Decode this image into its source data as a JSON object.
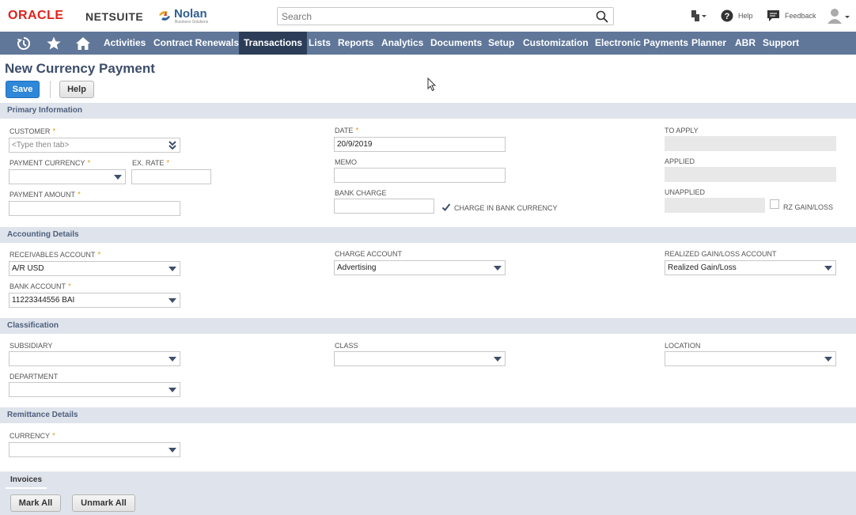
{
  "header": {
    "oracle": "ORACLE",
    "netsuite": "NETSUITE",
    "nolan": "Nolan",
    "nolan_sub": "Business Solutions",
    "search_placeholder": "Search",
    "help_label": "Help",
    "feedback_label": "Feedback"
  },
  "nav": {
    "icons": [
      "recent-icon",
      "star-icon",
      "home-icon"
    ],
    "items": [
      "Activities",
      "Contract Renewals",
      "Transactions",
      "Lists",
      "Reports",
      "Analytics",
      "Documents",
      "Setup",
      "Customization",
      "Electronic Payments",
      "Planner",
      "ABR",
      "Support"
    ],
    "active": "Transactions"
  },
  "page": {
    "title": "New Currency Payment",
    "save": "Save",
    "help": "Help"
  },
  "primary": {
    "header": "Primary Information",
    "customer_label": "CUSTOMER",
    "customer_placeholder": "<Type then tab>",
    "payment_currency_label": "PAYMENT CURRENCY",
    "ex_rate_label": "EX. RATE",
    "payment_amount_label": "PAYMENT AMOUNT",
    "date_label": "DATE",
    "date_value": "20/9/2019",
    "memo_label": "MEMO",
    "bank_charge_label": "BANK CHARGE",
    "charge_in_bank_currency_label": "CHARGE IN BANK CURRENCY",
    "charge_in_bank_currency_checked": true,
    "to_apply_label": "TO APPLY",
    "applied_label": "APPLIED",
    "unapplied_label": "UNAPPLIED",
    "rz_gain_loss_label": "RZ GAIN/LOSS",
    "rz_gain_loss_checked": false
  },
  "accounting": {
    "header": "Accounting Details",
    "receivables_label": "RECEIVABLES ACCOUNT",
    "receivables_value": "A/R USD",
    "bank_account_label": "BANK ACCOUNT",
    "bank_account_value": "11223344556 BAI",
    "charge_account_label": "CHARGE ACCOUNT",
    "charge_account_value": "Advertising",
    "realized_label": "REALIZED GAIN/LOSS ACCOUNT",
    "realized_value": "Realized Gain/Loss"
  },
  "classification": {
    "header": "Classification",
    "subsidiary_label": "SUBSIDIARY",
    "department_label": "DEPARTMENT",
    "class_label": "CLASS",
    "location_label": "LOCATION"
  },
  "remittance": {
    "header": "Remittance Details",
    "currency_label": "CURRENCY"
  },
  "invoices": {
    "tab": "Invoices",
    "mark_all": "Mark All",
    "unmark_all": "Unmark All"
  },
  "colors": {
    "navbar": "#607799",
    "nav_active": "#2c3e57",
    "save_button": "#2f87d8",
    "section_header": "#dfe4ec",
    "required_star": "#e4a225",
    "oracle_red": "#e0211b"
  }
}
